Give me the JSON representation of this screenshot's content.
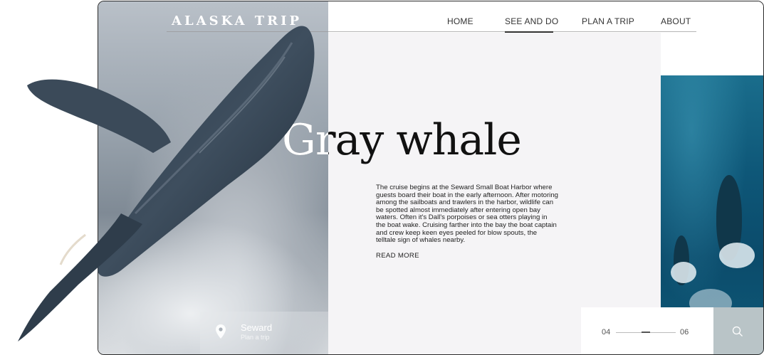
{
  "brand": {
    "title": "ALASKA TRIP"
  },
  "nav": {
    "items": [
      {
        "label": "HOME"
      },
      {
        "label": "SEE AND DO"
      },
      {
        "label": "PLAN A TRIP"
      },
      {
        "label": "ABOUT"
      }
    ],
    "active": "SEE AND DO"
  },
  "hero": {
    "title": "Gray whale",
    "description": "The cruise begins at the Seward Small Boat Harbor where guests board their boat in the early afternoon. After motoring among the sailboats and trawlers in the harbor, wildlife can be spotted almost immediately after entering open bay waters. Often it's Dall's porpoises or sea otters playing in the boat wake. Cruising farther into the bay the boat captain and crew keep keen eyes peeled for blow spouts, the telltale sign of whales nearby.",
    "read_more": "READ MORE"
  },
  "location": {
    "name": "Seward",
    "link": "Plan a trip",
    "icon": "map-pin-icon"
  },
  "pager": {
    "current": "04",
    "total": "06",
    "position_fraction": 0.5
  },
  "search": {
    "icon": "search-icon"
  },
  "colors": {
    "text_dark": "#111111",
    "ocean": "#0e5778",
    "background": "#f5f4f6"
  }
}
